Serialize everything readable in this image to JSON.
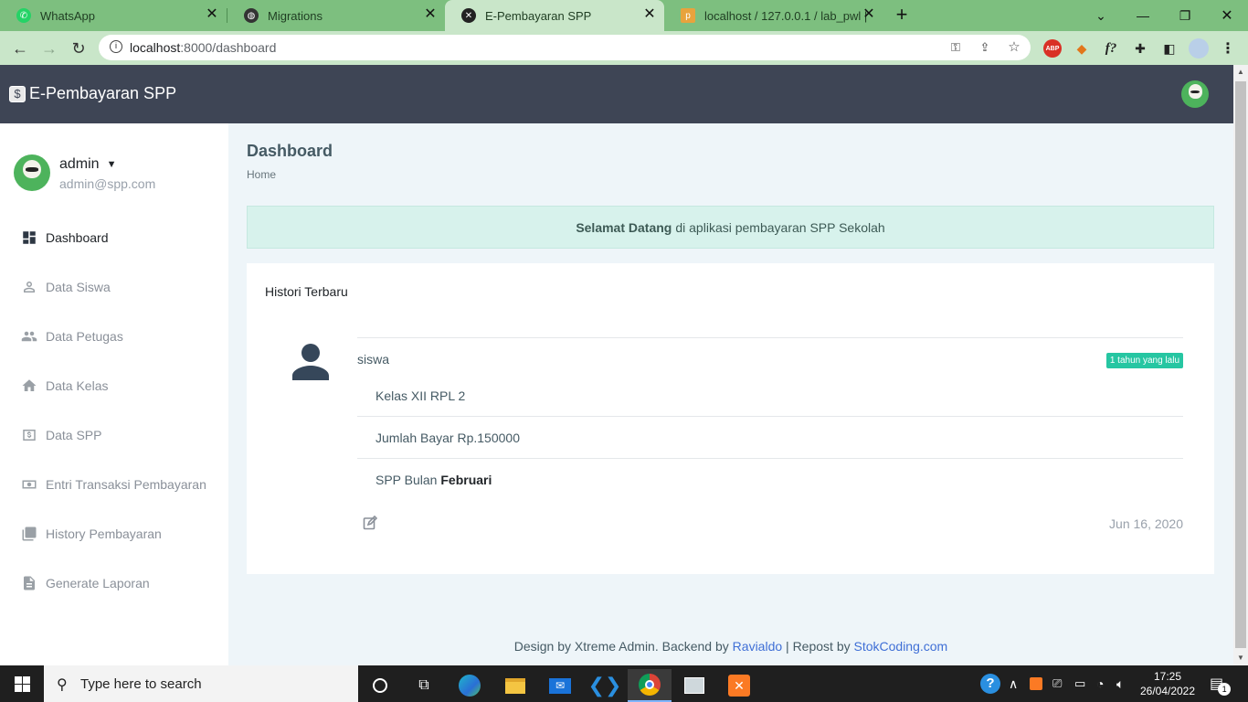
{
  "browser": {
    "tabs": [
      {
        "title": "WhatsApp"
      },
      {
        "title": "Migrations"
      },
      {
        "title": "E-Pembayaran SPP"
      },
      {
        "title": "localhost / 127.0.0.1 / lab_pwl | p"
      }
    ],
    "url_host": "localhost",
    "url_path": ":8000/dashboard",
    "ext_abp": "ABP",
    "ext_f": "f?"
  },
  "app": {
    "brand": "E-Pembayaran SPP",
    "brand_logo": "$"
  },
  "user": {
    "name": "admin",
    "email": "admin@spp.com"
  },
  "menu": [
    {
      "label": "Dashboard",
      "icon": "dashboard-icon",
      "active": true
    },
    {
      "label": "Data Siswa",
      "icon": "person-icon"
    },
    {
      "label": "Data Petugas",
      "icon": "people-icon"
    },
    {
      "label": "Data Kelas",
      "icon": "home-icon"
    },
    {
      "label": "Data SPP",
      "icon": "money-icon"
    },
    {
      "label": "Entri Transaksi Pembayaran",
      "icon": "cash-icon"
    },
    {
      "label": "History Pembayaran",
      "icon": "library-icon"
    },
    {
      "label": "Generate Laporan",
      "icon": "document-icon"
    }
  ],
  "page": {
    "title": "Dashboard",
    "breadcrumb": "Home"
  },
  "welcome": {
    "bold": "Selamat Datang",
    "rest": "di aplikasi pembayaran SPP Sekolah"
  },
  "history": {
    "title": "Histori Terbaru",
    "item": {
      "name": "siswa",
      "badge": "1 tahun yang lalu",
      "kelas": "Kelas XII RPL 2",
      "jumlah": "Jumlah Bayar Rp.150000",
      "bulan_prefix": "SPP Bulan",
      "bulan": "Februari",
      "date": "Jun 16, 2020"
    }
  },
  "footer": {
    "text1": "Design by Xtreme Admin. Backend by",
    "link1": "Ravialdo",
    "text2": "| Repost by",
    "link2": "StokCoding.com"
  },
  "taskbar": {
    "search_placeholder": "Type here to search",
    "time": "17:25",
    "date": "26/04/2022",
    "notif_count": "1"
  },
  "colors": {
    "header_bg": "#3e4555",
    "accent": "#26c6a2",
    "alert_bg": "#d7f2ec",
    "main_bg": "#eef5f9"
  }
}
